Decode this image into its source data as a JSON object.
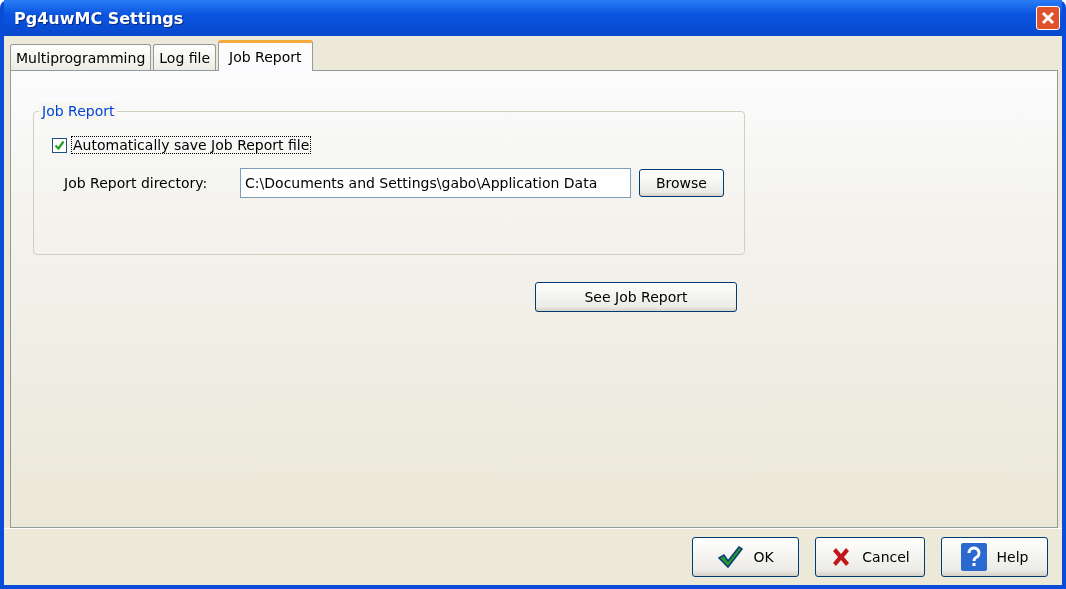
{
  "window": {
    "title": "Pg4uwMC Settings"
  },
  "tabs": [
    {
      "label": "Multiprogramming",
      "selected": false
    },
    {
      "label": "Log file",
      "selected": false
    },
    {
      "label": "Job Report",
      "selected": true
    }
  ],
  "group": {
    "title": "Job Report",
    "autosave": {
      "label": "Automatically save Job Report file",
      "checked": true
    },
    "directory": {
      "label": "Job Report directory:",
      "value": "C:\\Documents and Settings\\gabo\\Application Data"
    },
    "browse": "Browse"
  },
  "see_report": "See Job Report",
  "buttons": [
    {
      "kind": "ok",
      "label": "OK"
    },
    {
      "kind": "cancel",
      "label": "Cancel"
    },
    {
      "kind": "help",
      "label": "Help"
    }
  ]
}
